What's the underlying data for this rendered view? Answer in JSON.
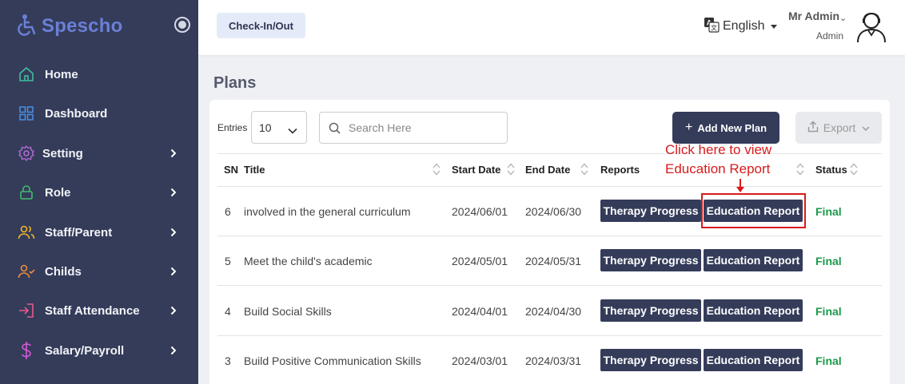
{
  "brand": {
    "name": "Spescho"
  },
  "sidebar": {
    "items": [
      {
        "label": "Home",
        "icon": "home-icon",
        "color": "#3fbf9b",
        "has_children": false
      },
      {
        "label": "Dashboard",
        "icon": "grid-icon",
        "color": "#4a90e2",
        "has_children": false
      },
      {
        "label": "Setting",
        "icon": "gear-icon",
        "color": "#b36bd6",
        "has_children": true
      },
      {
        "label": "Role",
        "icon": "lock-icon",
        "color": "#3fbf6b",
        "has_children": true
      },
      {
        "label": "Staff/Parent",
        "icon": "users-icon",
        "color": "#f0b429",
        "has_children": true
      },
      {
        "label": "Childs",
        "icon": "user-check-icon",
        "color": "#f08a3a",
        "has_children": true
      },
      {
        "label": "Staff Attendance",
        "icon": "login-icon",
        "color": "#e8578a",
        "has_children": true
      },
      {
        "label": "Salary/Payroll",
        "icon": "dollar-icon",
        "color": "#d45ad8",
        "has_children": true
      }
    ]
  },
  "topbar": {
    "checkin_label": "Check-In/Out",
    "language": "English",
    "user_name": "Mr Admin",
    "user_role": "Admin"
  },
  "page": {
    "title": "Plans"
  },
  "toolbar": {
    "entries_label": "Entries",
    "entries_value": "10",
    "search_placeholder": "Search Here",
    "add_label": "Add New Plan",
    "export_label": "Export"
  },
  "annotation": {
    "line1": "Click here to view",
    "line2": "Education Report"
  },
  "table": {
    "headers": {
      "sn": "SN",
      "title": "Title",
      "start": "Start Date",
      "end": "End Date",
      "reports": "Reports",
      "status": "Status"
    },
    "rows": [
      {
        "sn": "6",
        "title": "involved in the general curriculum",
        "start": "2024/06/01",
        "end": "2024/06/30",
        "therapy": "Therapy Progress",
        "education": "Education Report",
        "status": "Final"
      },
      {
        "sn": "5",
        "title": "Meet the child's academic",
        "start": "2024/05/01",
        "end": "2024/05/31",
        "therapy": "Therapy Progress",
        "education": "Education Report",
        "status": "Final"
      },
      {
        "sn": "4",
        "title": "Build Social Skills",
        "start": "2024/04/01",
        "end": "2024/04/30",
        "therapy": "Therapy Progress",
        "education": "Education Report",
        "status": "Final"
      },
      {
        "sn": "3",
        "title": "Build Positive Communication Skills",
        "start": "2024/03/01",
        "end": "2024/03/31",
        "therapy": "Therapy Progress",
        "education": "Education Report",
        "status": "Final"
      }
    ]
  },
  "colors": {
    "sidebar_bg": "#343c5a",
    "status_final": "#1b9a4a",
    "annotation": "#d81b1b",
    "brand": "#6b7fd7"
  }
}
